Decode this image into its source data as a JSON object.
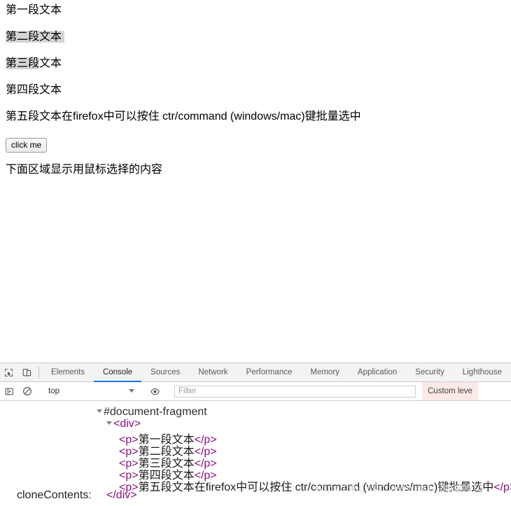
{
  "page": {
    "paragraphs": [
      {
        "id": "p1",
        "text": "第一段文本",
        "selection": "none"
      },
      {
        "id": "p2",
        "text": "第二段文本",
        "selection": "full"
      },
      {
        "id": "p3",
        "text": "第三段文本",
        "selection": "partial",
        "selected_part": "第三段",
        "unselected_part": "文本"
      },
      {
        "id": "p4",
        "text": "第四段文本",
        "selection": "none"
      },
      {
        "id": "p5",
        "text": "第五段文本在firefox中可以按住 ctr/command (windows/mac)键批量选中",
        "selection": "none"
      }
    ],
    "button_label": "click me",
    "hint_text": "下面区域显示用鼠标选择的内容",
    "selection_highlight_color": "#d6d6d6"
  },
  "devtools": {
    "toolbar_icons": [
      {
        "name": "inspect-element-icon",
        "glyph": "inspect"
      },
      {
        "name": "toggle-device-toolbar-icon",
        "glyph": "device"
      }
    ],
    "tabs": [
      {
        "label": "Elements",
        "active": false
      },
      {
        "label": "Console",
        "active": true
      },
      {
        "label": "Sources",
        "active": false
      },
      {
        "label": "Network",
        "active": false
      },
      {
        "label": "Performance",
        "active": false
      },
      {
        "label": "Memory",
        "active": false
      },
      {
        "label": "Application",
        "active": false
      },
      {
        "label": "Security",
        "active": false
      },
      {
        "label": "Lighthouse",
        "active": false
      }
    ],
    "active_tab_underline_color": "#1a73e8",
    "console_toolbar": {
      "execute_icon": "execution-context-icon",
      "clear_icon": "clear-console-icon",
      "context_value": "top",
      "eye_icon": "live-expression-icon",
      "filter_value": "",
      "filter_placeholder": "Filter",
      "level_label": "Custom leve",
      "level_badge_bg": "#fbe9e7"
    },
    "console_output": {
      "label_left": "cloneContents:",
      "tree": [
        {
          "indent": 0,
          "expanded": true,
          "text": "#document-fragment",
          "kind": "node"
        },
        {
          "indent": 1,
          "expanded": true,
          "text": "<div>",
          "kind": "tag"
        },
        {
          "indent": 2,
          "expanded": false,
          "open": "<p>",
          "content": "第一段文本",
          "close": "</p>",
          "kind": "element"
        },
        {
          "indent": 2,
          "expanded": false,
          "open": "<p>",
          "content": "第二段文本",
          "close": "</p>",
          "kind": "element"
        },
        {
          "indent": 2,
          "expanded": false,
          "open": "<p>",
          "content": "第三段文本",
          "close": "</p>",
          "kind": "element"
        },
        {
          "indent": 2,
          "expanded": false,
          "open": "<p>",
          "content": "第四段文本",
          "close": "</p>",
          "kind": "element"
        },
        {
          "indent": 2,
          "expanded": false,
          "open": "<p>",
          "content": "第五段文本在firefox中可以按住 ctr/command (windows/mac)键批量选中",
          "close": "</p>",
          "kind": "element"
        },
        {
          "indent": 1,
          "expanded": false,
          "text": "</div>",
          "kind": "tag"
        }
      ],
      "tag_color": "#881280"
    }
  },
  "watermark": "https://blog.csdn.net/weixin_38080573"
}
